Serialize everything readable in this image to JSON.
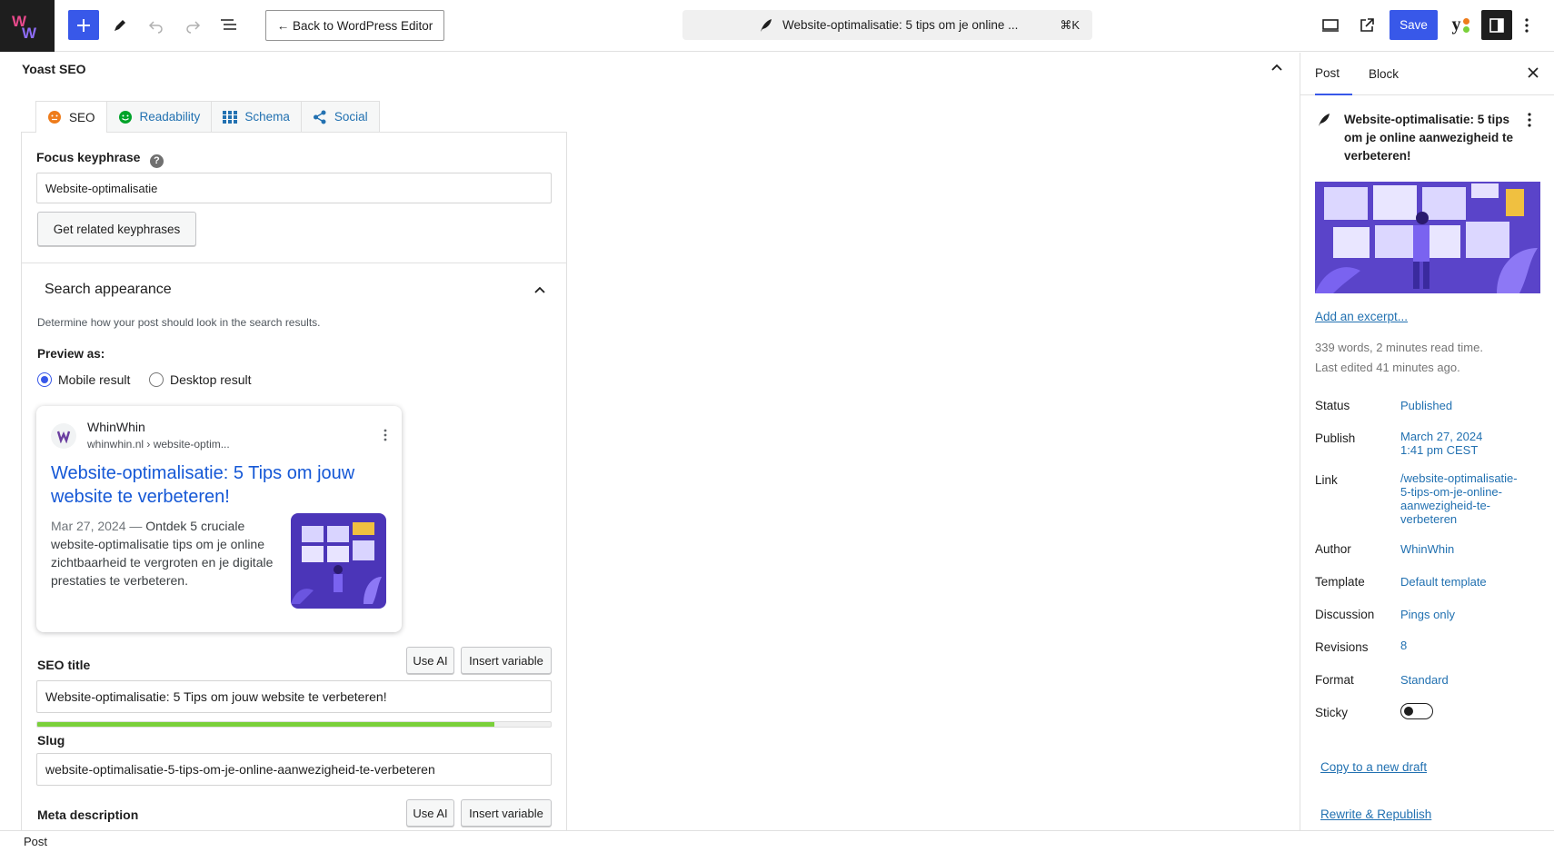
{
  "topbar": {
    "back_label": "← Back to WordPress Editor",
    "doc_title": "Website-optimalisatie: 5 tips om je online ...",
    "shortcut": "⌘K",
    "save_label": "Save",
    "yoast_glyph": "y",
    "icons": [
      "plus-icon",
      "pencil-icon",
      "undo-icon",
      "redo-icon",
      "list-view-icon",
      "preview-icon",
      "external-link-icon",
      "yoast-icon",
      "sidebar-icon",
      "more-icon"
    ]
  },
  "yoast": {
    "panel_title": "Yoast SEO",
    "tabs": [
      {
        "label": "SEO",
        "icon": "seo-face-icon"
      },
      {
        "label": "Readability",
        "icon": "readability-face-icon"
      },
      {
        "label": "Schema",
        "icon": "schema-grid-icon"
      },
      {
        "label": "Social",
        "icon": "share-icon"
      }
    ],
    "focus_label": "Focus keyphrase",
    "focus_help": "?",
    "focus_value": "Website-optimalisatie",
    "related_btn": "Get related keyphrases",
    "search_appearance": "Search appearance",
    "sa_desc": "Determine how your post should look in the search results.",
    "preview_as": "Preview as:",
    "mobile_label": "Mobile result",
    "desktop_label": "Desktop result",
    "preview": {
      "site_name": "WhinWhin",
      "breadcrumb": "whinwhin.nl › website-optim...",
      "title": "Website-optimalisatie: 5 Tips om jouw website te verbeteren!",
      "date": "Mar 27, 2024",
      "separator": "—",
      "description": "Ontdek 5 cruciale website-optimalisatie tips om je online zichtbaarheid te vergroten en je digitale prestaties te verbeteren."
    },
    "seo_title_label": "SEO title",
    "use_ai": "Use AI",
    "insert_variable": "Insert variable",
    "seo_title_value": "Website-optimalisatie: 5 Tips om jouw website te verbeteren!",
    "seo_title_progress": 0.89,
    "slug_label": "Slug",
    "slug_value": "website-optimalisatie-5-tips-om-je-online-aanwezigheid-te-verbeteren",
    "meta_label": "Meta description"
  },
  "status_bar": "Post",
  "sidebar": {
    "tab_post": "Post",
    "tab_block": "Block",
    "post_title": "Website-optimalisatie: 5 tips om je online aanwezigheid te verbeteren!",
    "excerpt_link": "Add an excerpt...",
    "words": "339 words, 2 minutes read time.",
    "edited": "Last edited 41 minutes ago.",
    "rows": {
      "status_label": "Status",
      "status_value": "Published",
      "publish_label": "Publish",
      "publish_value_1": "March 27, 2024",
      "publish_value_2": "1:41 pm CEST",
      "link_label": "Link",
      "link_value": "/website-optimalisatie-5-tips-om-je-online-aanwezigheid-te-verbeteren",
      "author_label": "Author",
      "author_value": "WhinWhin",
      "template_label": "Template",
      "template_value": "Default template",
      "discussion_label": "Discussion",
      "discussion_value": "Pings only",
      "revisions_label": "Revisions",
      "revisions_value": "8",
      "format_label": "Format",
      "format_value": "Standard",
      "sticky_label": "Sticky"
    },
    "sticky_on": false,
    "copy_draft": "Copy to a new draft",
    "rewrite": "Rewrite & Republish"
  },
  "colors": {
    "accent": "#3858e9",
    "link": "#2271b1",
    "good": "#7ad03a",
    "seo_orange": "#ee7c1b"
  }
}
